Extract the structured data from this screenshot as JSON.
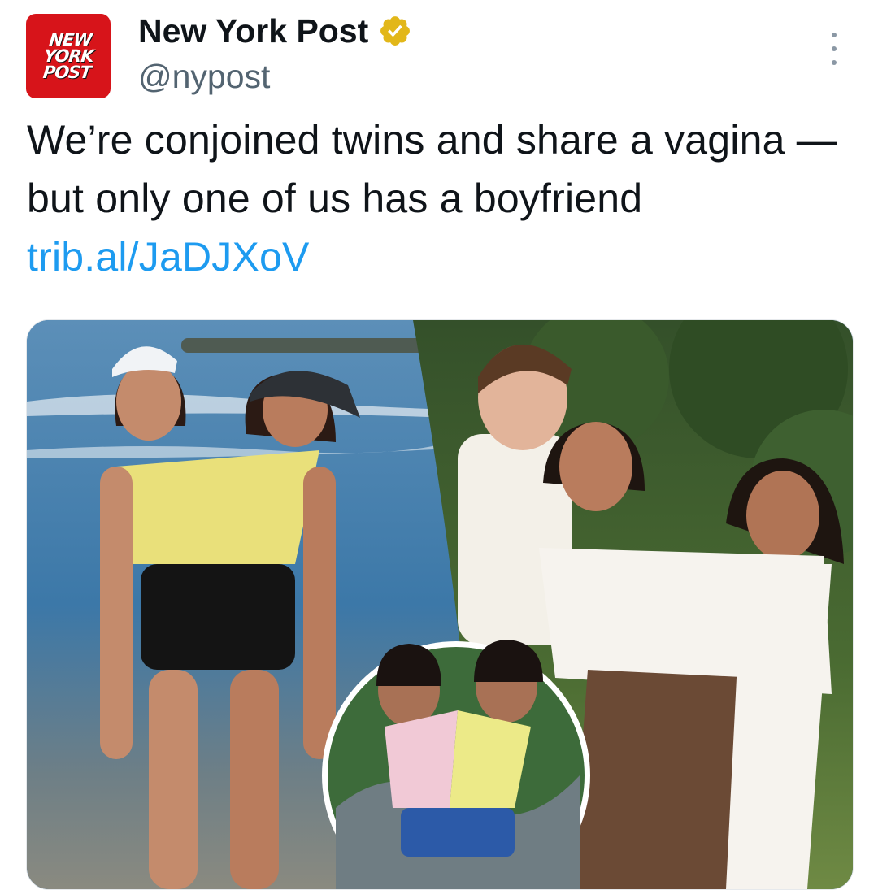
{
  "account": {
    "logo_text_line1": "NEW",
    "logo_text_line2": "YORK",
    "logo_text_line3": "POST",
    "display_name": "New York Post",
    "handle": "@nypost",
    "verified_icon": "verified-gold-badge-icon",
    "verified_color": "#e2b719"
  },
  "menu": {
    "icon": "more-vertical-icon"
  },
  "tweet": {
    "text": "We’re conjoined twins and share a vagina — but only one of us has a boyfriend",
    "link_text": "trib.al/JaDJXoV",
    "link_color": "#1d9bf0"
  },
  "media": {
    "description_icon": "photo-collage"
  }
}
